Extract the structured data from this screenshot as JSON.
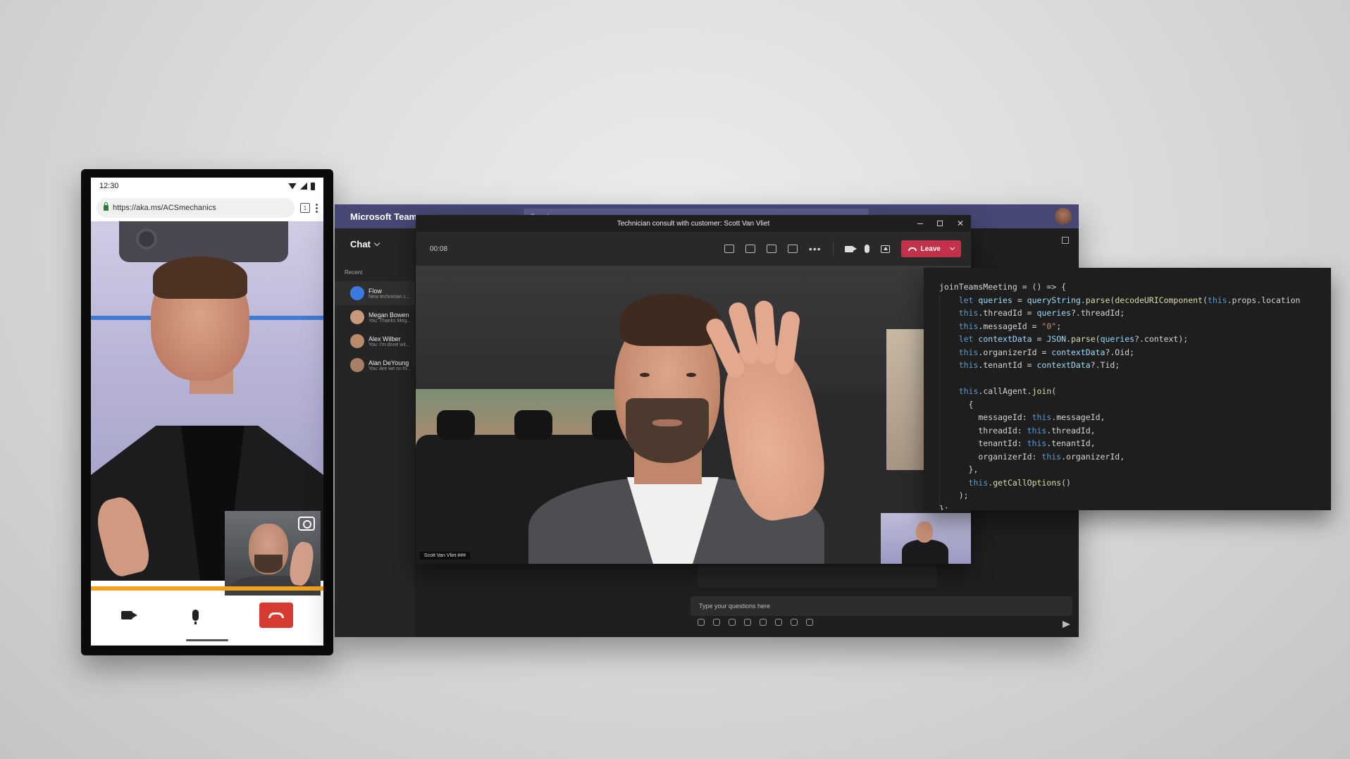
{
  "phone": {
    "time": "12:30",
    "url": "https://aka.ms/ACSmechanics",
    "tabs_count": "1",
    "controls": {
      "video_icon": "video-camera-icon",
      "mic_icon": "microphone-icon",
      "hangup_icon": "hang-up-icon"
    }
  },
  "teams": {
    "app_title": "Microsoft Teams",
    "search_placeholder": "Search",
    "chat_label": "Chat",
    "recent_label": "Recent",
    "chats": [
      {
        "name": "Flow",
        "preview": "New technician c..."
      },
      {
        "name": "Megan Bowen",
        "preview": "You: Thanks Meg..."
      },
      {
        "name": "Alex Wilber",
        "preview": "You: I'm done wit..."
      },
      {
        "name": "Alan DeYoung",
        "preview": "You: Are we on fo..."
      }
    ],
    "compose_placeholder": "Type your questions here"
  },
  "meeting": {
    "title": "Technician consult with customer: Scott Van Vliet",
    "timer": "00:08",
    "leave_label": "Leave",
    "participant_name": "Scott Van Vliet ###"
  },
  "code": {
    "lines": [
      "joinTeamsMeeting = () => {",
      "    let queries = queryString.parse(decodeURIComponent(this.props.location",
      "    this.threadId = queries?.threadId;",
      "    this.messageId = \"0\";",
      "    let contextData = JSON.parse(queries?.context);",
      "    this.organizerId = contextData?.Oid;",
      "    this.tenantId = contextData?.Tid;",
      "",
      "    this.callAgent.join(",
      "      {",
      "        messageId: this.messageId,",
      "        threadId: this.threadId,",
      "        tenantId: this.tenantId,",
      "        organizerId: this.organizerId,",
      "      },",
      "      this.getCallOptions()",
      "    );",
      "};"
    ]
  },
  "colors": {
    "teams_purple": "#464775",
    "leave_red": "#c4314b",
    "phone_hangup_red": "#d63a30",
    "phone_progress_orange": "#f4a21b"
  }
}
